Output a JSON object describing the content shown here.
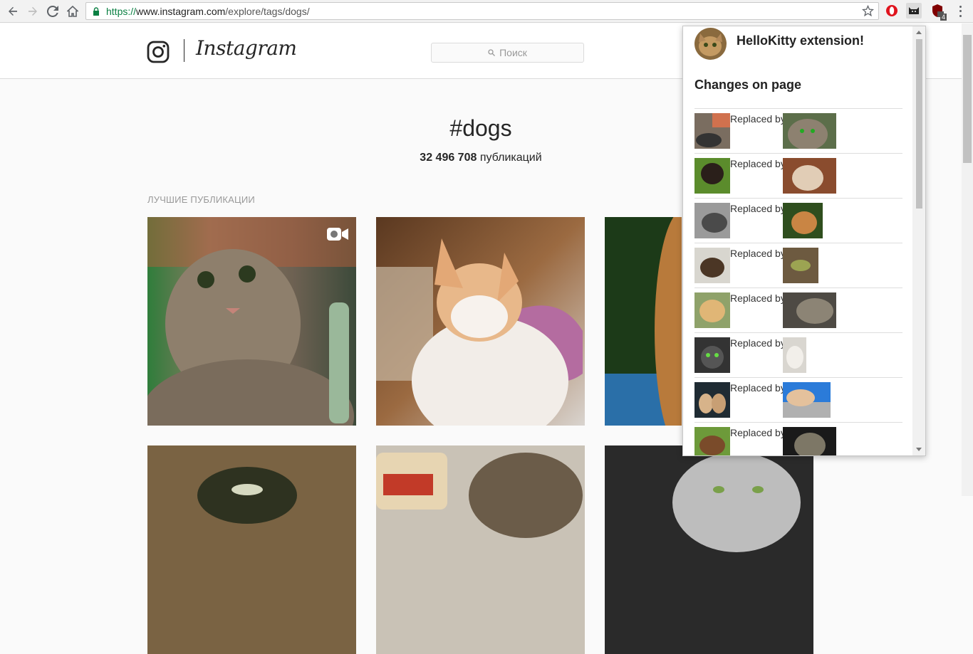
{
  "browser": {
    "url_scheme": "https://",
    "url_host": "www.instagram.com",
    "url_path": "/explore/tags/dogs/",
    "ublock_badge": "4"
  },
  "header": {
    "wordmark": "Instagram",
    "search_placeholder": "Поиск"
  },
  "tag": {
    "title": "#dogs",
    "count": "32 496 708",
    "count_suffix": "публикаций",
    "section_label": "ЛУЧШИЕ ПУБЛИКАЦИИ"
  },
  "popup": {
    "title": "HelloKitty extension!",
    "subtitle": "Changes on page",
    "replaced_label": "Replaced by",
    "rows": 8
  }
}
